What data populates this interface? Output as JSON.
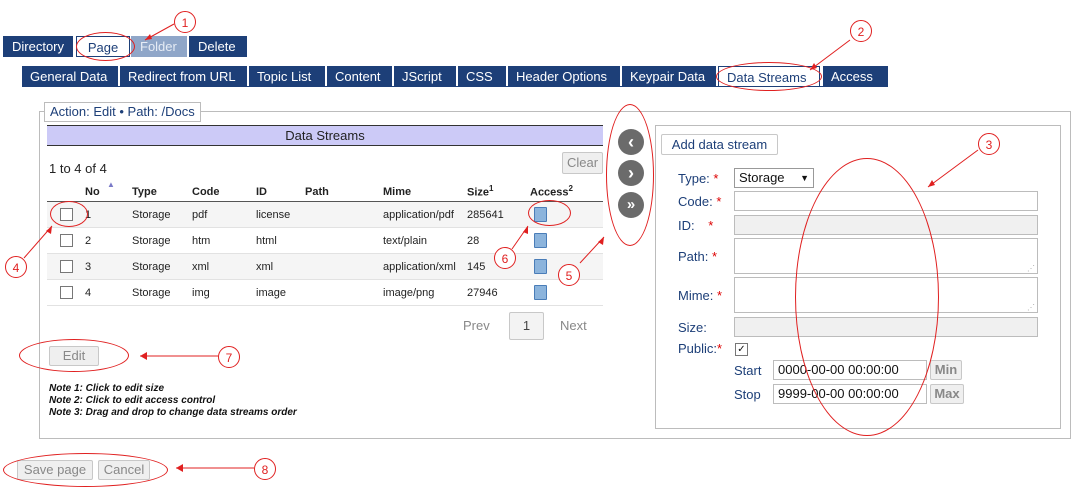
{
  "top_tabs": [
    "Directory",
    "Page",
    "Folder",
    "Delete"
  ],
  "sub_tabs": [
    "General Data",
    "Redirect from URL",
    "Topic List",
    "Content",
    "JScript",
    "CSS",
    "Header Options",
    "Keypair Data",
    "Data Streams",
    "Access"
  ],
  "action_legend": "Action: Edit • Path: /Docs",
  "panel_title": "Data Streams",
  "record_count": "1 to 4 of 4",
  "clear_label": "Clear",
  "columns": {
    "no": "No",
    "type": "Type",
    "code": "Code",
    "id": "ID",
    "path": "Path",
    "mime": "Mime",
    "size": "Size",
    "size_sup": "1",
    "access": "Access",
    "access_sup": "2"
  },
  "rows": [
    {
      "no": "1",
      "type": "Storage",
      "code": "pdf",
      "id": "license",
      "path": "",
      "mime": "application/pdf",
      "size": "285641"
    },
    {
      "no": "2",
      "type": "Storage",
      "code": "htm",
      "id": "html",
      "path": "",
      "mime": "text/plain",
      "size": "28"
    },
    {
      "no": "3",
      "type": "Storage",
      "code": "xml",
      "id": "xml",
      "path": "",
      "mime": "application/xml",
      "size": "145"
    },
    {
      "no": "4",
      "type": "Storage",
      "code": "img",
      "id": "image",
      "path": "",
      "mime": "image/png",
      "size": "27946"
    }
  ],
  "pager": {
    "prev": "Prev",
    "page": "1",
    "next": "Next"
  },
  "edit_label": "Edit",
  "notes": [
    "Note 1: Click to edit size",
    "Note 2: Click to edit access control",
    "Note 3: Drag and drop to change data streams order"
  ],
  "form": {
    "add_label": "Add data stream",
    "type_label": "Type:",
    "type_value": "Storage",
    "code_label": "Code:",
    "id_label": "ID:",
    "path_label": "Path:",
    "mime_label": "Mime:",
    "size_label": "Size:",
    "public_label": "Public:",
    "public_checked": true,
    "start_label": "Start",
    "start_value": "0000-00-00 00:00:00",
    "min_label": "Min",
    "stop_label": "Stop",
    "stop_value": "9999-00-00 00:00:00",
    "max_label": "Max",
    "required_mark": "*"
  },
  "footer": {
    "save_label": "Save page",
    "cancel_label": "Cancel"
  },
  "annotations": [
    "1",
    "2",
    "3",
    "4",
    "5",
    "6",
    "7",
    "8"
  ],
  "colors": {
    "tab_blue": "#1d3f78",
    "header_lavender": "#cccaf7",
    "annotation_red": "#e02020"
  }
}
